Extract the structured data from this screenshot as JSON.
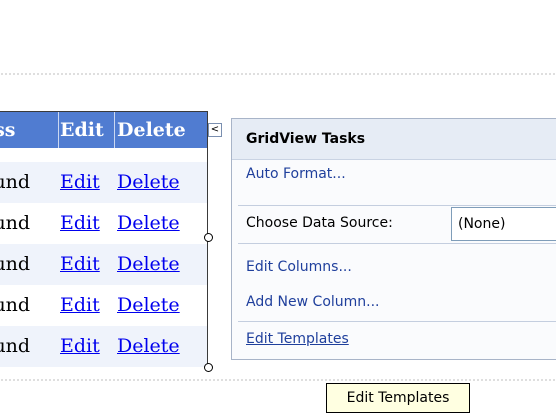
{
  "gridview": {
    "headers": [
      "ess",
      "Edit",
      "Delete"
    ],
    "rows": [
      [
        "ound",
        "Edit",
        "Delete"
      ],
      [
        "ound",
        "Edit",
        "Delete"
      ],
      [
        "ound",
        "Edit",
        "Delete"
      ],
      [
        "ound",
        "Edit",
        "Delete"
      ],
      [
        "ound",
        "Edit",
        "Delete"
      ]
    ]
  },
  "smart_tag": {
    "glyph": "<"
  },
  "tasks": {
    "title": "GridView Tasks",
    "auto_format": "Auto Format...",
    "choose_data_source_label": "Choose Data Source:",
    "data_source_value": "(None)",
    "edit_columns": "Edit Columns...",
    "add_new_column": "Add New Column...",
    "edit_templates": "Edit Templates"
  },
  "tooltip": {
    "text": "Edit Templates"
  },
  "colors": {
    "header_bg": "#507cd1",
    "alt_row_bg": "#eff3fb",
    "link": "#0000ee",
    "task_link": "#1f3f9c",
    "panel_title_bg": "#e6ecf5",
    "tooltip_bg": "#ffffe1"
  }
}
